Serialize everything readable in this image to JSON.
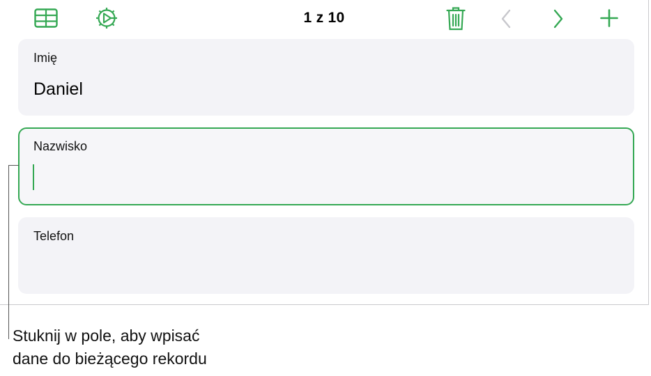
{
  "toolbar": {
    "record_count": "1 z 10",
    "icons": {
      "table": "table-icon",
      "settings": "gear-icon",
      "delete": "trash-icon",
      "previous": "chevron-left-icon",
      "next": "chevron-right-icon",
      "add": "plus-icon"
    }
  },
  "fields": [
    {
      "label": "Imię",
      "value": "Daniel"
    },
    {
      "label": "Nazwisko",
      "value": "",
      "active": true
    },
    {
      "label": "Telefon",
      "value": ""
    }
  ],
  "callout": {
    "line1": "Stuknij w pole, aby wpisać",
    "line2": "dane do bieżącego rekordu"
  },
  "colors": {
    "accent": "#34a853",
    "field_background": "#f3f3f7",
    "disabled": "#c7c7cc"
  }
}
